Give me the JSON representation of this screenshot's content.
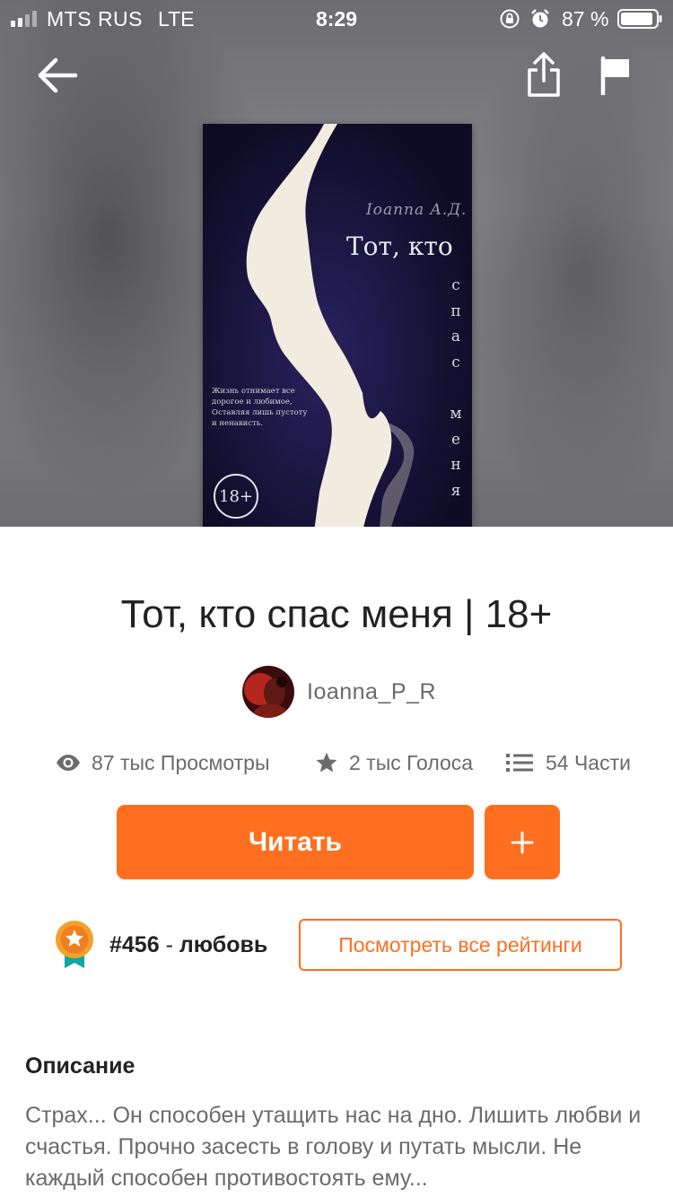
{
  "status_bar": {
    "carrier": "MTS RUS",
    "network": "LTE",
    "time": "8:29",
    "battery": "87 %"
  },
  "cover": {
    "author": "Ioanna A.Д.",
    "title": "Тот, кто",
    "vertical_letters": [
      "с",
      "п",
      "а",
      "с",
      "",
      "м",
      "е",
      "н",
      "я"
    ],
    "blurb": "Жизнь отнимает все дорогое и любимое, Оставляя лишь пустоту и ненависть.",
    "age_badge": "18+",
    "background_color": "#0e0b24"
  },
  "book": {
    "title": "Тот, кто спас меня | 18+",
    "author": "Ioanna_P_R"
  },
  "stats": {
    "views": "87 тыс Просмотры",
    "votes": "2 тыс Голоса",
    "parts": "54 Части"
  },
  "actions": {
    "read_label": "Читать",
    "add_label": "+",
    "accent_color": "#ff6f1f"
  },
  "ranking": {
    "rank": "#456",
    "separator": " - ",
    "tag": "любовь",
    "view_all_label": "Посмотреть все рейтинги"
  },
  "description": {
    "heading": "Описание",
    "text": "Страх... Он способен утащить нас на дно. Лишить любви и счастья. Прочно засесть в голову и путать мысли. Не каждый способен противостоять ему..."
  },
  "icons": {
    "back": "arrow-left-icon",
    "share": "share-icon",
    "report": "flag-icon",
    "views": "eye-icon",
    "votes": "star-icon",
    "parts": "list-icon",
    "ranking": "medal-icon"
  }
}
